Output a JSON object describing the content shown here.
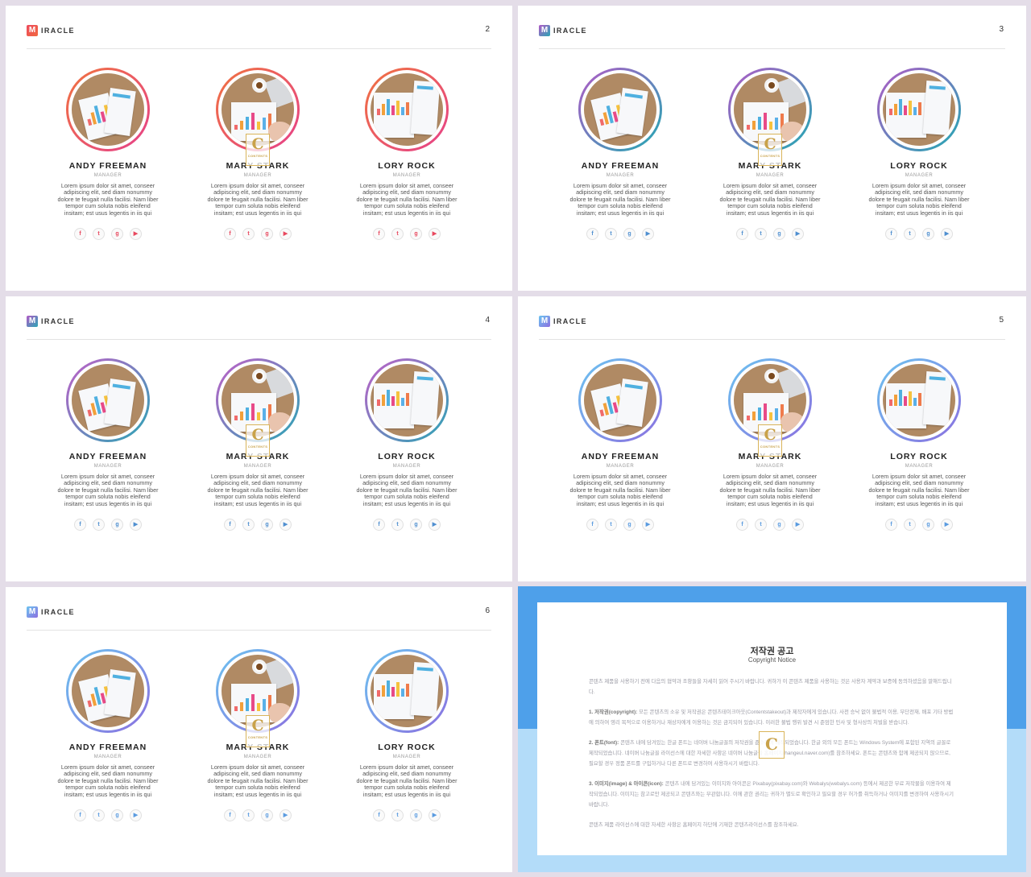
{
  "brand": {
    "letter": "M",
    "text": "IRACLE"
  },
  "people": [
    {
      "name": "ANDY FREEMAN",
      "role": "MANAGER",
      "desc": "Lorem ipsum dolor sit amet, conseer adipiscing elit, sed diam nonummy dolore te feugait nulla facilisi. Nam liber tempor cum soluta nobis eleifend insitam; est usus legentis in iis qui"
    },
    {
      "name": "MARY STARK",
      "role": "MANAGER",
      "desc": "Lorem ipsum dolor sit amet, conseer adipiscing elit, sed diam nonummy dolore te feugait nulla facilisi. Nam liber tempor cum soluta nobis eleifend insitam; est usus legentis in iis qui"
    },
    {
      "name": "LORY ROCK",
      "role": "MANAGER",
      "desc": "Lorem ipsum dolor sit amet, conseer adipiscing elit, sed diam nonummy dolore te feugait nulla facilisi. Nam liber tempor cum soluta nobis eleifend insitam; est usus legentis in iis qui"
    }
  ],
  "social_icons": [
    {
      "glyph": "f",
      "name": "facebook-icon"
    },
    {
      "glyph": "t",
      "name": "twitter-icon"
    },
    {
      "glyph": "g",
      "name": "google-plus-icon"
    },
    {
      "glyph": "▶",
      "name": "youtube-icon"
    }
  ],
  "watermark": {
    "letter": "C",
    "text": "CONTENTS"
  },
  "slides": [
    {
      "number": "2",
      "logo_colors": [
        "#ee4a5d",
        "#f0683f"
      ],
      "ring_colors": [
        "#f0733f",
        "#e6418a"
      ],
      "icon_color": "#e8485e"
    },
    {
      "number": "3",
      "logo_colors": [
        "#b25ac6",
        "#2aa6b5"
      ],
      "ring_colors": [
        "#b25ac6",
        "#21aab3"
      ],
      "icon_color": "#4f8fd0"
    },
    {
      "number": "4",
      "logo_colors": [
        "#b25ac6",
        "#2aa6b5"
      ],
      "ring_colors": [
        "#c15fc8",
        "#2aa6b5"
      ],
      "icon_color": "#4f8fd0"
    },
    {
      "number": "5",
      "logo_colors": [
        "#6cc4f0",
        "#8b6fe0"
      ],
      "ring_colors": [
        "#6cc4f0",
        "#8b6fe0"
      ],
      "icon_color": "#5a9be0"
    },
    {
      "number": "6",
      "logo_colors": [
        "#6cc4f0",
        "#8b6fe0"
      ],
      "ring_colors": [
        "#6cc4f0",
        "#8b6fe0"
      ],
      "icon_color": "#5a9be0"
    }
  ],
  "copyright": {
    "title": "저작권 공고",
    "subtitle": "Copyright Notice",
    "intro": "콘텐츠 제품을 사용하기 전에 다음의 협약과 조항들을 자세히 읽어 주시기 바랍니다. 귀하가 이 콘텐츠 제품을 사용하는 것은 사용자 계약과 보증에 동의하셨음을 말해드립니다.",
    "p1_label": "1. 저작권(copyright):",
    "p1": " 모든 콘텐츠의 소유 및 저작권은 콘텐츠테이크아웃(Contentstakeout)과 제작자에게 있습니다. 사전 승낙 없이 불법적 이용, 무단전재, 배포 기타 방법에 의하여 영리 목적으로 이용하거나 재상자에게 이용하는 것은 금지되어 있습니다. 이러한 불법 행위 발견 시 준엄한 민사 및 형사상의 처벌을 받습니다.",
    "p2_label": "2. 폰트(font):",
    "p2": " 콘텐츠 내에 담겨있는 한글 폰트는 네이버 나눔글꼴의 저작권을 준수하여 제작되었습니다. 한글 외의 모든 폰트는 Windows System에 포함된 지역의 글꼴로 제작되었습니다. 네이버 나눔글꼴 라이선스에 대한 자세한 사항은 네이버 나눔글꼴 홈페이지(hangeul.naver.com)를 참조하세요. 폰트는 콘텐츠와 함께 제공되지 않으므로, 필요할 경우 정품 폰트를 구입하거나 다른 폰트로 변경하여 사용하시기 바랍니다.",
    "p3_label": "3. 이미지(image) & 아이콘(icon):",
    "p3": " 콘텐츠 내에 담겨있는 이미지와 아이콘은 Pixabay(pixabay.com)와 Webalys(webalys.com) 등에서 제공한 무료 저작물을 이용하여 제작되었습니다. 이미지는 참고로만 제공되고 콘텐츠와는 무관합니다. 이에 관한 권리는 귀하가 별도로 확인하고 필요할 경우 허가를 취득하거나 이미지를 변경하여 사용하시기 바랍니다.",
    "footer": "콘텐츠 제품 라이선스에 대한 자세한 사항은 홈페이지 하단에 기재한 콘텐츠라이선스를 참조하세요.",
    "mark": "C"
  }
}
